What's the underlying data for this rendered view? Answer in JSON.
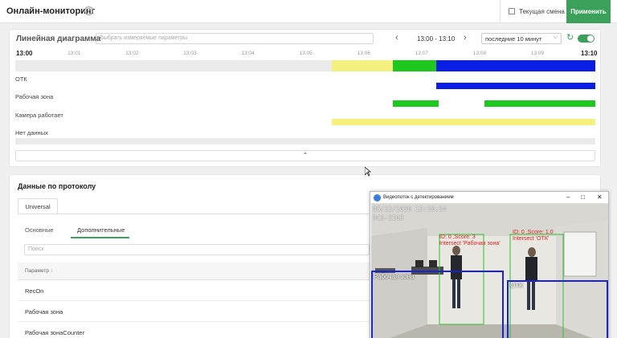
{
  "header": {
    "title": "Онлайн-мониторинг",
    "help_icon": "?",
    "shift_label": "Текущая смена",
    "apply_label": "Применить"
  },
  "linechart": {
    "title": "Линейная диаграмма",
    "params_placeholder": "Выбрать измеряемые параметры",
    "range": "13:00 - 13:10",
    "period": "последние 10 минут",
    "ticks": [
      "13:00",
      "13:01",
      "13:02",
      "13:03",
      "13:04",
      "13:05",
      "13:06",
      "13:07",
      "13:08",
      "13:09",
      "13:10"
    ],
    "rows": [
      {
        "label": "ОТК"
      },
      {
        "label": "Рабочая зона"
      },
      {
        "label": "Камера работает"
      },
      {
        "label": "Нет данных"
      }
    ],
    "colors": {
      "yellow": "#f4f17e",
      "green": "#1ec81e",
      "blue": "#0a1ee6",
      "gray": "#ebebec"
    }
  },
  "chart_data": {
    "type": "bar",
    "x": [
      "13:00",
      "13:01",
      "13:02",
      "13:03",
      "13:04",
      "13:05",
      "13:06",
      "13:07",
      "13:08",
      "13:09",
      "13:10"
    ],
    "series": [
      {
        "name": "ОТК",
        "intervals": [
          [
            "13:07:15",
            "13:10:00"
          ]
        ]
      },
      {
        "name": "Рабочая зона",
        "intervals": [
          [
            "13:06:30",
            "13:07:18"
          ],
          [
            "13:08:05",
            "13:10:00"
          ]
        ]
      },
      {
        "name": "Нет данных",
        "intervals": [
          [
            "13:05:27",
            "13:10:00"
          ]
        ]
      }
    ],
    "summary_row": [
      {
        "from": "13:05:27",
        "to": "13:06:30",
        "color": "yellow"
      },
      {
        "from": "13:06:30",
        "to": "13:07:15",
        "color": "green"
      },
      {
        "from": "13:07:15",
        "to": "13:10:00",
        "color": "blue"
      }
    ],
    "title": "Линейная диаграмма"
  },
  "protocol": {
    "title": "Данные по протоколу",
    "tab": "Universal",
    "subtabs": [
      "Основные",
      "Дополнительные"
    ],
    "search_placeholder": "Поиск",
    "column_header": "Параметр",
    "rows": [
      "RecOn",
      "Рабочая зона",
      "Рабочая зонаCounter"
    ]
  },
  "video": {
    "title": "Видеопоток с детектированием",
    "timestamp": "05/22/2020  13:10:24",
    "camera": "DCS-2103",
    "det1": [
      "ID: 0 ,Score: 3",
      "Intersect 'Рабочая зона'"
    ],
    "det2": [
      "ID: 0 ,Score: 1.0",
      "Intersect 'ОТК'"
    ],
    "zone_work": "Рабочая зона",
    "zone_otk": "ОТК"
  }
}
